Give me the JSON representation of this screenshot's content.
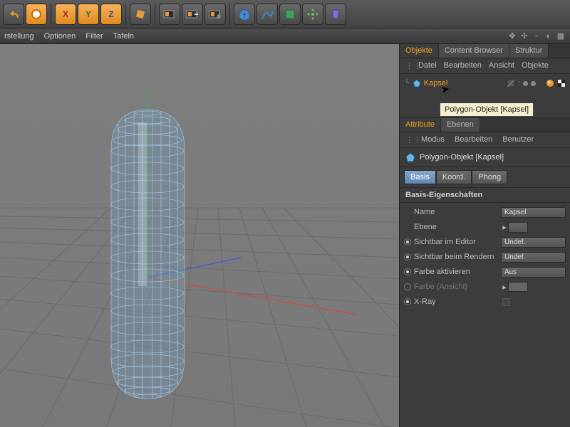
{
  "toolbar_icons": [
    {
      "name": "undo-icon"
    },
    {
      "name": "redo-icon"
    },
    {
      "name": "axis-x-icon",
      "label": "X",
      "orange": true
    },
    {
      "name": "axis-y-icon",
      "label": "Y",
      "orange": true
    },
    {
      "name": "axis-z-icon",
      "label": "Z",
      "orange": true
    },
    {
      "name": "coord-system-icon"
    },
    {
      "name": "render-view-icon"
    },
    {
      "name": "render-region-icon"
    },
    {
      "name": "render-settings-icon"
    },
    {
      "name": "cube-primitive-icon"
    },
    {
      "name": "spline-icon"
    },
    {
      "name": "nurbs-icon"
    },
    {
      "name": "array-icon"
    },
    {
      "name": "deformer-icon"
    }
  ],
  "menu": {
    "items": [
      "rstellung",
      "Optionen",
      "Filter",
      "Tafeln"
    ]
  },
  "viewport_widget_icons": [
    "⚙",
    "↔",
    "⤢",
    "▦",
    "▭"
  ],
  "panels": {
    "top_tabs": [
      {
        "label": "Objekte",
        "active": true
      },
      {
        "label": "Content Browser"
      },
      {
        "label": "Struktur"
      }
    ],
    "top_menu": [
      "Datei",
      "Bearbeiten",
      "Ansicht",
      "Objekte"
    ],
    "object_name": "Kapsel",
    "tooltip": "Polygon-Objekt [Kapsel]"
  },
  "attributes": {
    "tabs": [
      {
        "label": "Attribute",
        "active": true
      },
      {
        "label": "Ebenen"
      }
    ],
    "menu": [
      "Modus",
      "Bearbeiten",
      "Benutzer"
    ],
    "title": "Polygon-Objekt [Kapsel]",
    "subtabs": [
      {
        "label": "Basis",
        "active": true
      },
      {
        "label": "Koord."
      },
      {
        "label": "Phong"
      }
    ],
    "section": "Basis-Eigenschaften",
    "props": [
      {
        "label": "Name",
        "type": "field",
        "value": "Kapsel"
      },
      {
        "label": "Ebene",
        "type": "field",
        "value": ""
      },
      {
        "label": "Sichtbar im Editor",
        "type": "dropdown",
        "value": "Undef.",
        "radio": true
      },
      {
        "label": "Sichtbar beim Rendern",
        "type": "dropdown",
        "value": "Undef.",
        "radio": true
      },
      {
        "label": "Farbe aktivieren",
        "type": "dropdown",
        "value": "Aus",
        "radio": true
      },
      {
        "label": "Farbe (Ansicht)",
        "type": "swatch",
        "disabled": true,
        "radio": true
      },
      {
        "label": "X-Ray",
        "type": "checkbox",
        "radio": true
      }
    ]
  }
}
